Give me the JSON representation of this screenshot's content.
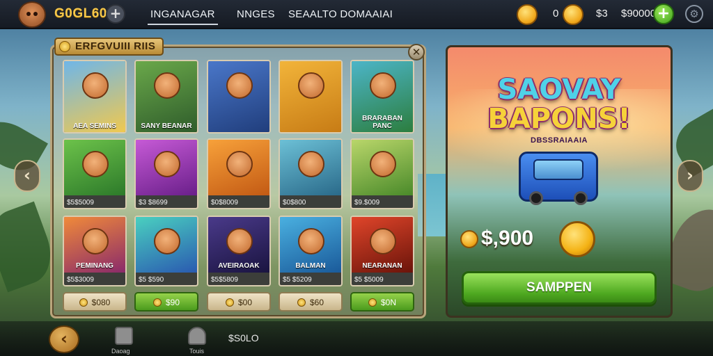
{
  "topbar": {
    "gold": "G0GL60",
    "tabs": [
      "INGANAGAR",
      "NNGES",
      "SEAALTO DOMAAIAI"
    ],
    "currency_value": "0",
    "currency_mid": "$3",
    "currency_right": "$90000"
  },
  "panel": {
    "title": "ERFGVUIII RIIS",
    "close_symbol": "✕",
    "cards": [
      {
        "caption": "AEA SEMINS",
        "price": "",
        "badge": "",
        "art": [
          "#6fb6e8",
          "#f4c94a"
        ]
      },
      {
        "caption": "SANY BEANAR",
        "price": "",
        "badge": "",
        "art": [
          "#6aa84a",
          "#2d5a2a"
        ]
      },
      {
        "caption": "",
        "price": "",
        "badge": "",
        "art": [
          "#4a77c9",
          "#1f3c7a"
        ]
      },
      {
        "caption": "",
        "price": "",
        "badge": "",
        "art": [
          "#f2b43a",
          "#c67a14"
        ]
      },
      {
        "caption": "BRARABAN PANC",
        "price": "",
        "badge": "",
        "art": [
          "#4cb5c8",
          "#2b7c3a"
        ]
      },
      {
        "caption": "",
        "price": "$5$5009",
        "badge": "",
        "art": [
          "#6cc24a",
          "#2d7a2a"
        ]
      },
      {
        "caption": "",
        "price": "$3 $8699",
        "badge": "",
        "art": [
          "#c65ad6",
          "#6a1f8a"
        ]
      },
      {
        "caption": "",
        "price": "$0$8009",
        "badge": "",
        "art": [
          "#f7a13a",
          "#c35a14"
        ]
      },
      {
        "caption": "",
        "price": "$0$800",
        "badge": "",
        "art": [
          "#6cc0d6",
          "#2a6a8a"
        ]
      },
      {
        "caption": "",
        "price": "$9.$009",
        "badge": "",
        "art": [
          "#b9d66a",
          "#4a8a2a"
        ]
      },
      {
        "caption": "PEMINANG",
        "price": "$5$3009",
        "badge": "",
        "art": [
          "#f08a3a",
          "#8a2a6a"
        ]
      },
      {
        "caption": "",
        "price": "$5 $590",
        "badge": "",
        "art": [
          "#4ad0c0",
          "#2a5ab0"
        ]
      },
      {
        "caption": "AVEIRAOAK",
        "price": "$5$5809",
        "badge": "",
        "art": [
          "#4a3a8a",
          "#1a1440"
        ]
      },
      {
        "caption": "BALMAN",
        "price": "$5 $5209",
        "badge": "",
        "art": [
          "#4ab0e0",
          "#1a5a9a"
        ]
      },
      {
        "caption": "NEARANAN",
        "price": "$5 $5009",
        "badge": "",
        "art": [
          "#e0452a",
          "#6a140a"
        ]
      }
    ],
    "buttons": [
      {
        "label": "$080",
        "style": "tan"
      },
      {
        "label": "$90",
        "style": "green"
      },
      {
        "label": "$00",
        "style": "tan"
      },
      {
        "label": "$60",
        "style": "tan"
      },
      {
        "label": "$0N",
        "style": "green"
      }
    ]
  },
  "promo": {
    "title_line1": "SAOVAY",
    "title_line2": "BAPONS!",
    "subtitle": "DBSSRAIAAIA",
    "price": "$,900",
    "cta": "SAMPPEN"
  },
  "bottombar": {
    "items": [
      {
        "label": "Daoag",
        "icon": "tower-icon"
      },
      {
        "label": "Touis",
        "icon": "helmet-icon"
      }
    ],
    "count": "$S0LO"
  },
  "colors": {
    "accent_green": "#4ea820",
    "gold": "#f7c84a",
    "topbar": "#1b212b"
  }
}
